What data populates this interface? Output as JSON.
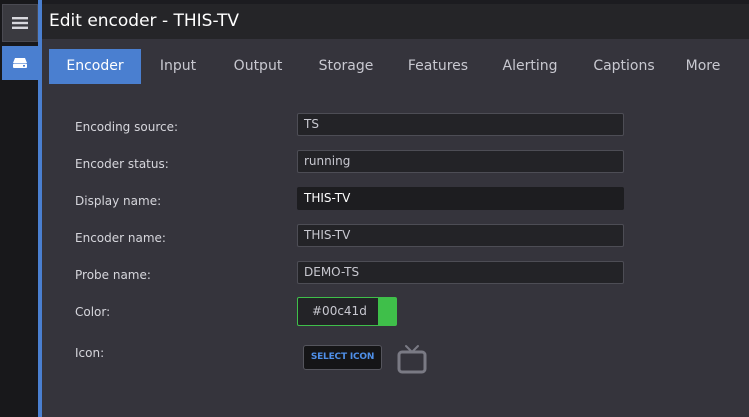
{
  "window": {
    "title": "Edit encoder - THIS-TV"
  },
  "sidebar": {
    "items": [
      {
        "icon": "hamburger-menu-icon",
        "active": false
      },
      {
        "icon": "encoder-device-icon",
        "active": true
      }
    ]
  },
  "tabs": [
    {
      "label": "Encoder",
      "active": true
    },
    {
      "label": "Input",
      "active": false
    },
    {
      "label": "Output",
      "active": false
    },
    {
      "label": "Storage",
      "active": false
    },
    {
      "label": "Features",
      "active": false
    },
    {
      "label": "Alerting",
      "active": false
    },
    {
      "label": "Captions",
      "active": false
    },
    {
      "label": "More",
      "active": false
    }
  ],
  "form": {
    "encoding_source": {
      "label": "Encoding source:",
      "value": "TS"
    },
    "encoder_status": {
      "label": "Encoder status:",
      "value": "running"
    },
    "display_name": {
      "label": "Display name:",
      "value": "THIS-TV"
    },
    "encoder_name": {
      "label": "Encoder name:",
      "value": "THIS-TV"
    },
    "probe_name": {
      "label": "Probe name:",
      "value": "DEMO-TS"
    },
    "color": {
      "label": "Color:",
      "value": "#00c41d",
      "swatch": "#3fbf4a"
    },
    "icon": {
      "label": "Icon:",
      "button_label": "SELECT ICON",
      "preview_icon": "tv-icon"
    }
  },
  "colors": {
    "accent": "#4a7fd0",
    "background": "#35343c",
    "titlebar": "#252528"
  }
}
